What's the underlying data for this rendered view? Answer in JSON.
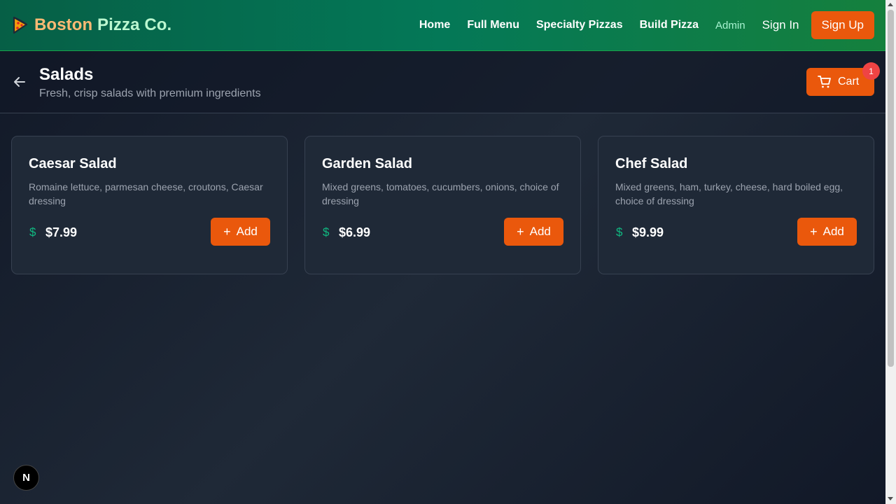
{
  "brand": {
    "part1": "Boston",
    "part2": "Pizza Co.",
    "icon": "pizza-slice-icon"
  },
  "nav": {
    "links": [
      "Home",
      "Full Menu",
      "Specialty Pizzas",
      "Build Pizza"
    ],
    "admin": "Admin",
    "sign_in": "Sign In",
    "sign_up": "Sign Up"
  },
  "category": {
    "title": "Salads",
    "subtitle": "Fresh, crisp salads with premium ingredients",
    "back_icon": "arrow-left-icon"
  },
  "cart": {
    "label": "Cart",
    "count": "1",
    "icon": "shopping-cart-icon"
  },
  "items": [
    {
      "name": "Caesar Salad",
      "description": "Romaine lettuce, parmesan cheese, croutons, Caesar dressing",
      "price_symbol": "$",
      "price": "$7.99",
      "add_label": "Add"
    },
    {
      "name": "Garden Salad",
      "description": "Mixed greens, tomatoes, cucumbers, onions, choice of dressing",
      "price_symbol": "$",
      "price": "$6.99",
      "add_label": "Add"
    },
    {
      "name": "Chef Salad",
      "description": "Mixed greens, ham, turkey, cheese, hard boiled egg, choice of dressing",
      "price_symbol": "$",
      "price": "$9.99",
      "add_label": "Add"
    }
  ],
  "dev_badge": "N",
  "colors": {
    "accent": "#ea580c",
    "header_green": "#047857",
    "price_green": "#10b981",
    "badge_red": "#ef4444"
  }
}
